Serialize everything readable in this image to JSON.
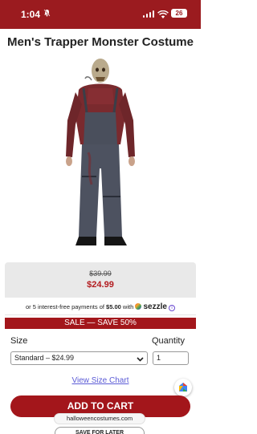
{
  "status_bar": {
    "time": "1:04",
    "battery": "26",
    "icons": [
      "bell-slash-icon",
      "signal-icon",
      "wifi-icon",
      "battery-icon"
    ],
    "background": "#9b1b1f"
  },
  "product": {
    "title": "Men's Trapper Monster Costume",
    "image_icon": "costume-photo"
  },
  "pricing": {
    "original_price": "$39.99",
    "sale_price": "$24.99",
    "installments_prefix": "or 5 interest-free payments of",
    "installment_amount": "$5.00",
    "installments_with": "with",
    "provider": "sezzle",
    "sale_banner": "SALE — SAVE 50%"
  },
  "options": {
    "size_label": "Size",
    "size_selected": "Standard – $24.99",
    "quantity_label": "Quantity",
    "quantity_value": "1",
    "size_chart_link": "View Size Chart"
  },
  "actions": {
    "add_to_cart": "ADD TO CART",
    "save_for_later": "SAVE FOR LATER"
  },
  "browser": {
    "url": "halloweencostumes.com"
  },
  "colors": {
    "brand_red": "#a3161b",
    "link_blue": "#5b5bd6",
    "panel_gray": "#e9e9e9"
  }
}
